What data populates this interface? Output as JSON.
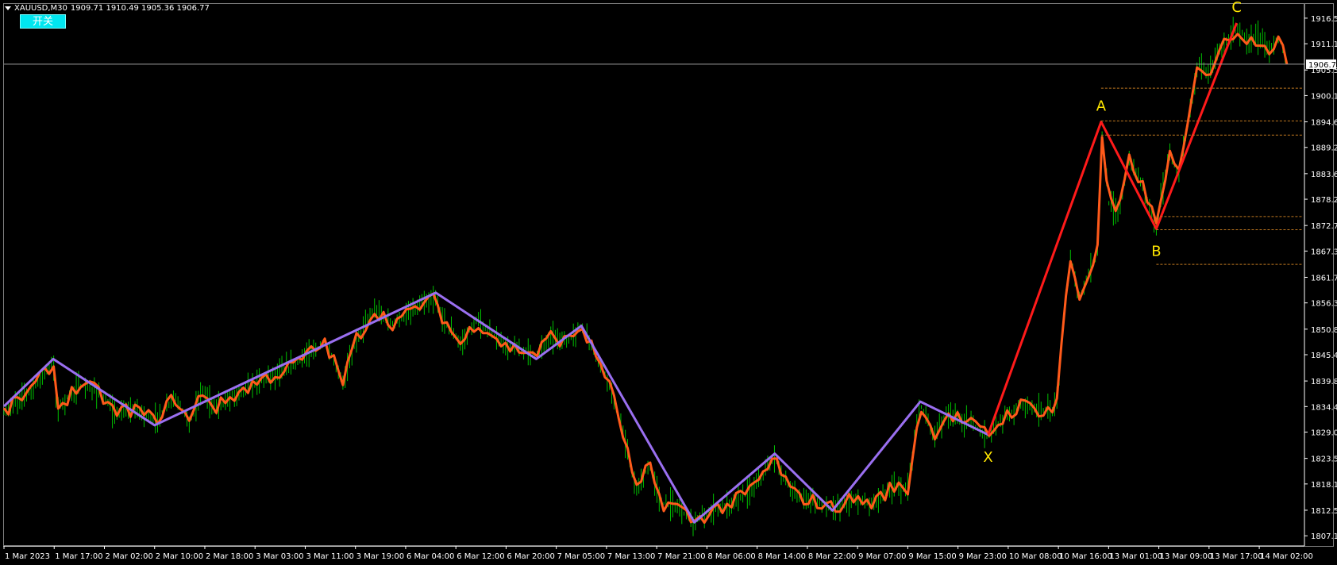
{
  "header": {
    "symbol": "XAUUSD,M30",
    "ohlc": "1909.71 1910.49 1905.36 1906.77",
    "toggle_label": "开关"
  },
  "colors": {
    "background": "#000000",
    "axis": "#ffffff",
    "candle": "#00c000",
    "zigzag": "#ff5a1a",
    "wave": "#9a6ff0",
    "pattern": "#ff1a1a",
    "label": "#ffe600",
    "level": "#c07820",
    "price_line": "#a0a0a0"
  },
  "chart_data": {
    "type": "line",
    "title": "XAUUSD,M30",
    "ylim": [
      1805.0,
      1919.5
    ],
    "current_price": 1906.77,
    "current_price_label": "1906.77",
    "yticks": [
      "1916.50",
      "1911.10",
      "1905.55",
      "1900.15",
      "1894.60",
      "1889.20",
      "1883.65",
      "1878.25",
      "1872.70",
      "1867.30",
      "1861.75",
      "1856.35",
      "1850.80",
      "1845.40",
      "1839.85",
      "1834.45",
      "1829.05",
      "1823.50",
      "1818.10",
      "1812.55",
      "1807.15"
    ],
    "xticks": [
      "1 Mar 2023",
      "1 Mar 17:00",
      "2 Mar 02:00",
      "2 Mar 10:00",
      "2 Mar 18:00",
      "3 Mar 03:00",
      "3 Mar 11:00",
      "3 Mar 19:00",
      "6 Mar 04:00",
      "6 Mar 12:00",
      "6 Mar 20:00",
      "7 Mar 05:00",
      "7 Mar 13:00",
      "7 Mar 21:00",
      "8 Mar 06:00",
      "8 Mar 14:00",
      "8 Mar 22:00",
      "9 Mar 07:00",
      "9 Mar 15:00",
      "9 Mar 23:00",
      "10 Mar 08:00",
      "10 Mar 16:00",
      "13 Mar 01:00",
      "13 Mar 09:00",
      "13 Mar 17:00",
      "14 Mar 02:00"
    ],
    "x_range": [
      0,
      25.9
    ],
    "series": [],
    "wave_points": [
      {
        "x": 0.0,
        "y": 1834.5
      },
      {
        "x": 0.98,
        "y": 1844.5
      },
      {
        "x": 3.0,
        "y": 1830.5
      },
      {
        "x": 8.6,
        "y": 1858.5
      },
      {
        "x": 10.6,
        "y": 1844.5
      },
      {
        "x": 11.5,
        "y": 1851.5
      },
      {
        "x": 13.75,
        "y": 1810.0
      },
      {
        "x": 15.35,
        "y": 1824.5
      },
      {
        "x": 16.5,
        "y": 1812.5
      },
      {
        "x": 18.25,
        "y": 1835.5
      },
      {
        "x": 19.6,
        "y": 1828.5
      }
    ],
    "pattern_points": [
      {
        "x": 19.6,
        "y": 1828.5,
        "label": "X"
      },
      {
        "x": 21.85,
        "y": 1894.6,
        "label": "A"
      },
      {
        "x": 22.95,
        "y": 1872.0,
        "label": "B"
      },
      {
        "x": 24.55,
        "y": 1915.5,
        "label": "C"
      }
    ],
    "levels": [
      {
        "y": 1901.7,
        "x_start": 21.85
      },
      {
        "y": 1894.8,
        "x_start": 21.85
      },
      {
        "y": 1891.8,
        "x_start": 21.85
      },
      {
        "y": 1874.6,
        "x_start": 22.95
      },
      {
        "y": 1871.8,
        "x_start": 22.95
      },
      {
        "y": 1864.5,
        "x_start": 22.95
      }
    ],
    "price_keypoints": [
      {
        "x": 0.0,
        "y": 1833.0
      },
      {
        "x": 0.35,
        "y": 1836.5
      },
      {
        "x": 0.6,
        "y": 1838.5
      },
      {
        "x": 0.98,
        "y": 1844.0
      },
      {
        "x": 1.05,
        "y": 1834.0
      },
      {
        "x": 1.5,
        "y": 1839.0
      },
      {
        "x": 1.9,
        "y": 1837.5
      },
      {
        "x": 2.2,
        "y": 1833.0
      },
      {
        "x": 2.6,
        "y": 1834.0
      },
      {
        "x": 3.0,
        "y": 1831.5
      },
      {
        "x": 3.4,
        "y": 1836.5
      },
      {
        "x": 3.7,
        "y": 1831.0
      },
      {
        "x": 3.95,
        "y": 1838.0
      },
      {
        "x": 4.2,
        "y": 1834.0
      },
      {
        "x": 4.6,
        "y": 1837.0
      },
      {
        "x": 5.1,
        "y": 1840.0
      },
      {
        "x": 5.6,
        "y": 1842.0
      },
      {
        "x": 6.0,
        "y": 1845.0
      },
      {
        "x": 6.4,
        "y": 1848.0
      },
      {
        "x": 6.75,
        "y": 1839.5
      },
      {
        "x": 7.0,
        "y": 1848.5
      },
      {
        "x": 7.4,
        "y": 1855.0
      },
      {
        "x": 7.7,
        "y": 1852.0
      },
      {
        "x": 8.0,
        "y": 1853.5
      },
      {
        "x": 8.3,
        "y": 1856.0
      },
      {
        "x": 8.6,
        "y": 1857.0
      },
      {
        "x": 8.75,
        "y": 1853.0
      },
      {
        "x": 9.1,
        "y": 1847.5
      },
      {
        "x": 9.4,
        "y": 1852.5
      },
      {
        "x": 9.7,
        "y": 1850.0
      },
      {
        "x": 10.0,
        "y": 1847.0
      },
      {
        "x": 10.3,
        "y": 1846.5
      },
      {
        "x": 10.6,
        "y": 1845.5
      },
      {
        "x": 10.9,
        "y": 1849.5
      },
      {
        "x": 11.2,
        "y": 1848.0
      },
      {
        "x": 11.5,
        "y": 1851.5
      },
      {
        "x": 11.7,
        "y": 1847.0
      },
      {
        "x": 12.0,
        "y": 1841.0
      },
      {
        "x": 12.3,
        "y": 1830.0
      },
      {
        "x": 12.6,
        "y": 1816.5
      },
      {
        "x": 12.85,
        "y": 1822.0
      },
      {
        "x": 13.1,
        "y": 1814.0
      },
      {
        "x": 13.4,
        "y": 1813.5
      },
      {
        "x": 13.75,
        "y": 1810.0
      },
      {
        "x": 14.1,
        "y": 1812.5
      },
      {
        "x": 14.5,
        "y": 1814.0
      },
      {
        "x": 14.9,
        "y": 1817.0
      },
      {
        "x": 15.35,
        "y": 1823.5
      },
      {
        "x": 15.7,
        "y": 1816.0
      },
      {
        "x": 16.1,
        "y": 1814.5
      },
      {
        "x": 16.5,
        "y": 1813.0
      },
      {
        "x": 16.9,
        "y": 1815.0
      },
      {
        "x": 17.3,
        "y": 1814.0
      },
      {
        "x": 17.7,
        "y": 1817.5
      },
      {
        "x": 18.0,
        "y": 1817.0
      },
      {
        "x": 18.25,
        "y": 1835.0
      },
      {
        "x": 18.5,
        "y": 1828.5
      },
      {
        "x": 18.8,
        "y": 1833.0
      },
      {
        "x": 19.2,
        "y": 1831.0
      },
      {
        "x": 19.6,
        "y": 1828.5
      },
      {
        "x": 20.0,
        "y": 1833.0
      },
      {
        "x": 20.3,
        "y": 1835.0
      },
      {
        "x": 20.7,
        "y": 1833.5
      },
      {
        "x": 20.95,
        "y": 1834.0
      },
      {
        "x": 21.1,
        "y": 1852.0
      },
      {
        "x": 21.25,
        "y": 1866.5
      },
      {
        "x": 21.4,
        "y": 1857.0
      },
      {
        "x": 21.6,
        "y": 1862.5
      },
      {
        "x": 21.8,
        "y": 1868.0
      },
      {
        "x": 21.85,
        "y": 1894.0
      },
      {
        "x": 22.0,
        "y": 1877.5
      },
      {
        "x": 22.2,
        "y": 1875.0
      },
      {
        "x": 22.4,
        "y": 1886.5
      },
      {
        "x": 22.6,
        "y": 1883.0
      },
      {
        "x": 22.8,
        "y": 1877.5
      },
      {
        "x": 22.95,
        "y": 1872.5
      },
      {
        "x": 23.2,
        "y": 1888.0
      },
      {
        "x": 23.4,
        "y": 1883.0
      },
      {
        "x": 23.6,
        "y": 1895.5
      },
      {
        "x": 23.8,
        "y": 1907.5
      },
      {
        "x": 24.0,
        "y": 1904.5
      },
      {
        "x": 24.2,
        "y": 1910.0
      },
      {
        "x": 24.4,
        "y": 1912.0
      },
      {
        "x": 24.55,
        "y": 1914.5
      },
      {
        "x": 24.8,
        "y": 1911.5
      },
      {
        "x": 25.0,
        "y": 1912.5
      },
      {
        "x": 25.2,
        "y": 1910.0
      },
      {
        "x": 25.4,
        "y": 1912.5
      },
      {
        "x": 25.55,
        "y": 1906.77
      }
    ]
  }
}
